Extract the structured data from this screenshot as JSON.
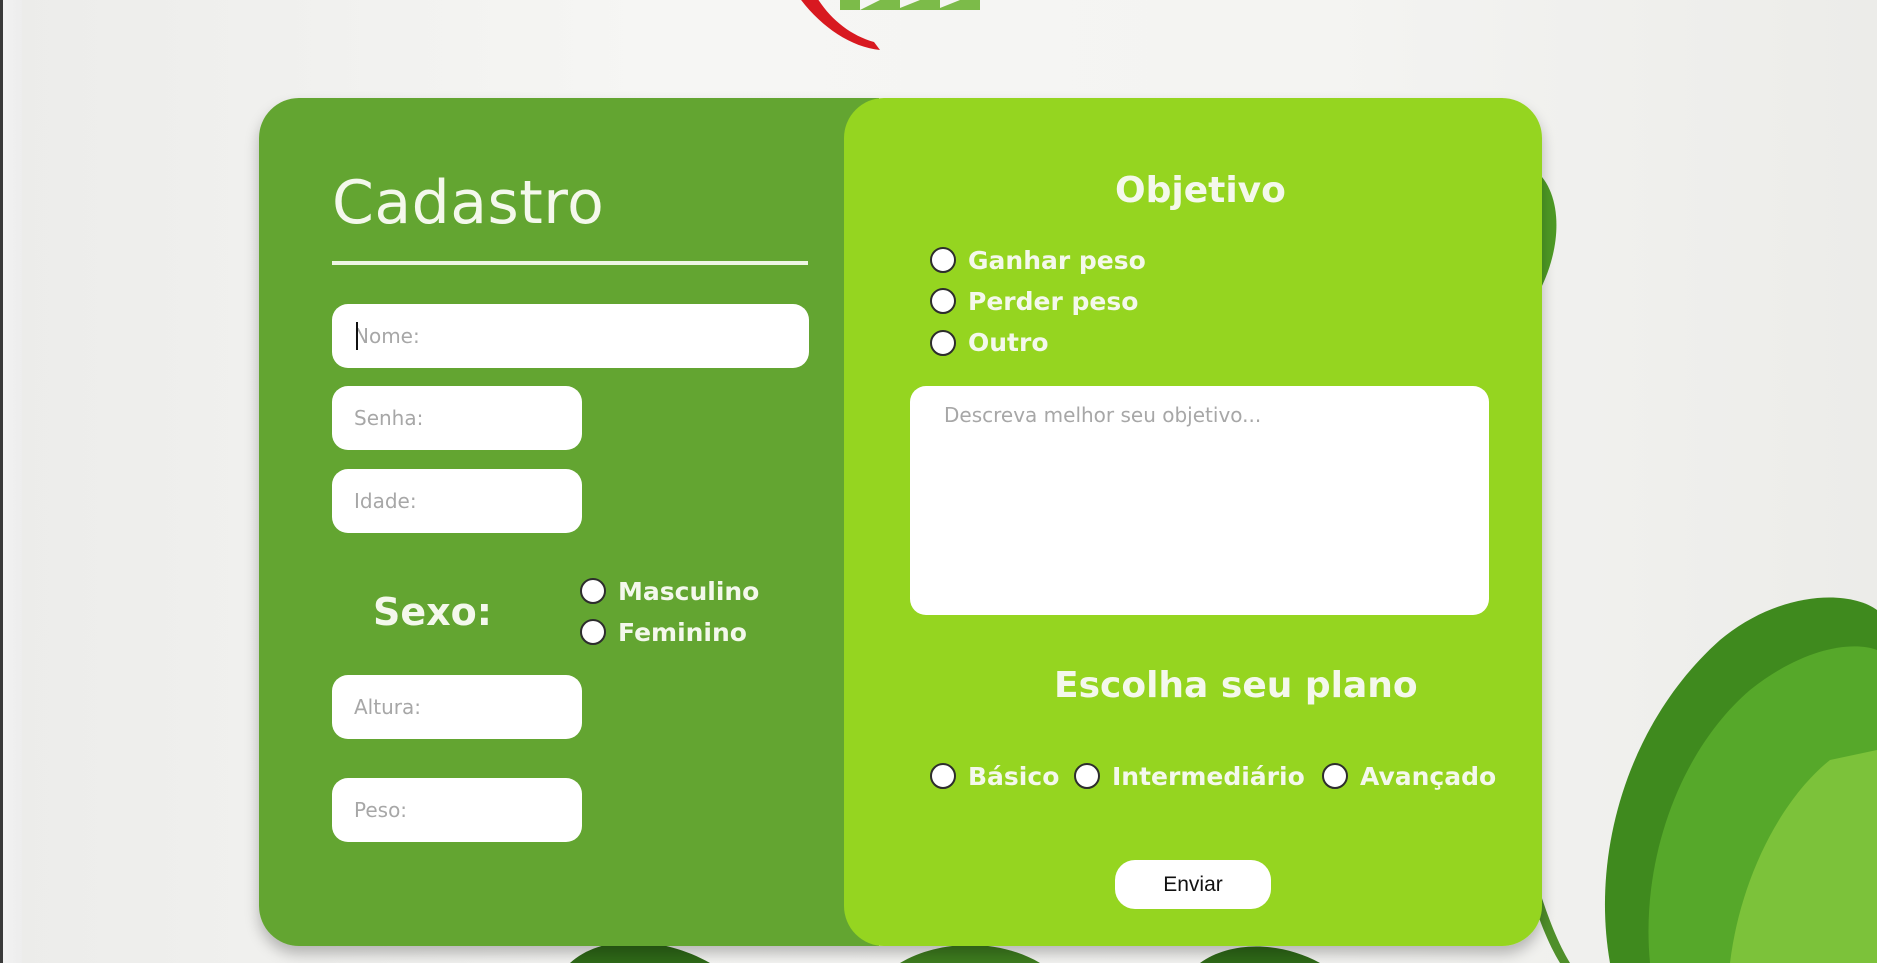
{
  "form": {
    "title": "Cadastro",
    "fields": {
      "nome": {
        "placeholder": "Nome:",
        "value": ""
      },
      "senha": {
        "placeholder": "Senha:",
        "value": ""
      },
      "idade": {
        "placeholder": "Idade:",
        "value": ""
      },
      "altura": {
        "placeholder": "Altura:",
        "value": ""
      },
      "peso": {
        "placeholder": "Peso:",
        "value": ""
      }
    },
    "sexo": {
      "label": "Sexo:",
      "options": [
        "Masculino",
        "Feminino"
      ]
    }
  },
  "objetivo": {
    "title": "Objetivo",
    "options": [
      "Ganhar peso",
      "Perder peso",
      "Outro"
    ],
    "description_placeholder": "Descreva melhor seu objetivo..."
  },
  "plano": {
    "title": "Escolha seu plano",
    "options": [
      "Básico",
      "Intermediário",
      "Avançado"
    ]
  },
  "submit_label": "Enviar",
  "colors": {
    "left_panel": "#63a531",
    "right_panel": "#95d520",
    "logo_arc": "#d81920",
    "logo_text": "#6fb536"
  }
}
